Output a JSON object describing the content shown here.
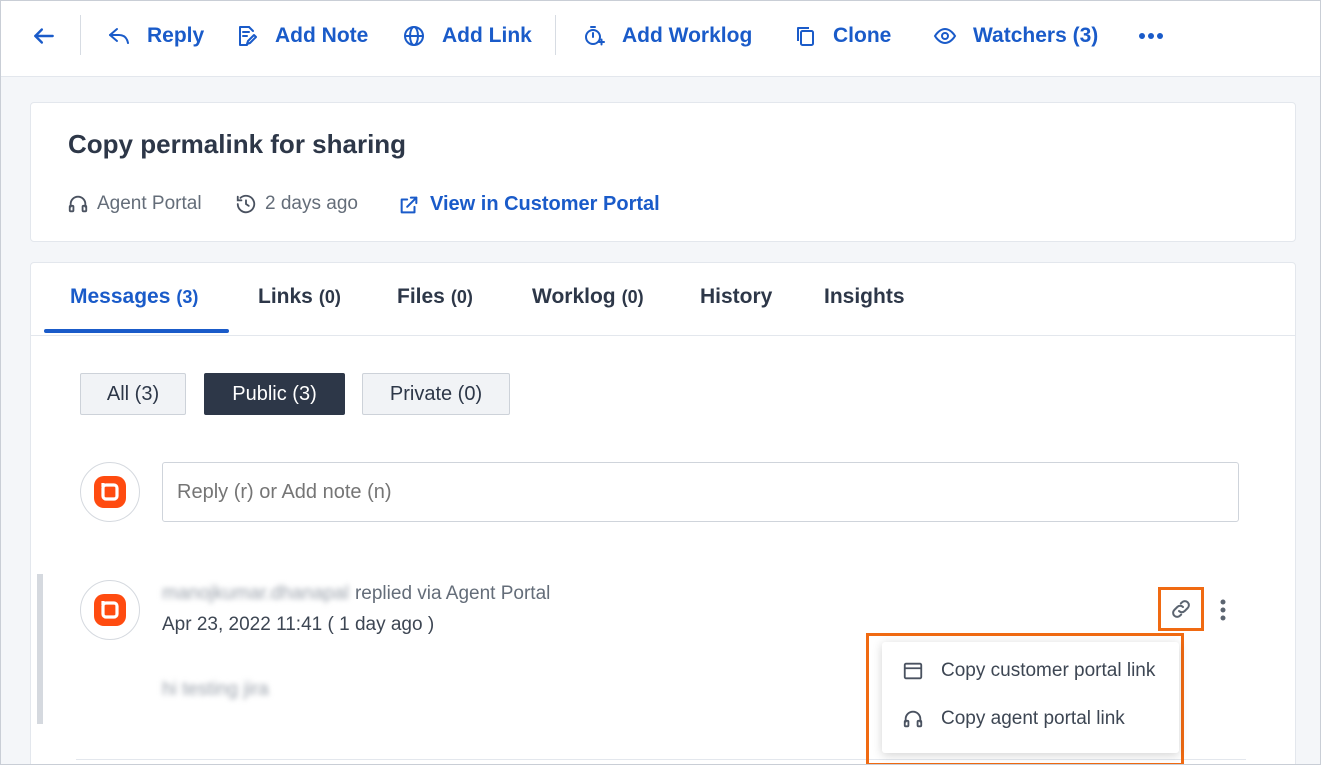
{
  "toolbar": {
    "reply": "Reply",
    "add_note": "Add Note",
    "add_link": "Add Link",
    "add_worklog": "Add Worklog",
    "clone": "Clone",
    "watchers": "Watchers (3)"
  },
  "header": {
    "title": "Copy permalink for sharing",
    "channel": "Agent Portal",
    "time": "2 days ago",
    "view_link": "View in Customer Portal"
  },
  "tabs": [
    {
      "label": "Messages",
      "count": "(3)"
    },
    {
      "label": "Links",
      "count": "(0)"
    },
    {
      "label": "Files",
      "count": "(0)"
    },
    {
      "label": "Worklog",
      "count": "(0)"
    },
    {
      "label": "History",
      "count": ""
    },
    {
      "label": "Insights",
      "count": ""
    }
  ],
  "filters": {
    "all": "All (3)",
    "public": "Public (3)",
    "private": "Private (0)"
  },
  "reply_box": {
    "placeholder": "Reply (r) or Add note (n)"
  },
  "message": {
    "author": "manojkumar.dhanapal",
    "via": "replied via Agent Portal",
    "date": "Apr 23, 2022 11:41 ( 1 day ago )",
    "body": "hi testing jira"
  },
  "dropdown": {
    "copy_customer": "Copy customer portal link",
    "copy_agent": "Copy agent portal link"
  },
  "colors": {
    "accent": "#1a5bc9",
    "highlight": "#f06a12",
    "logo": "#ff4b10"
  }
}
